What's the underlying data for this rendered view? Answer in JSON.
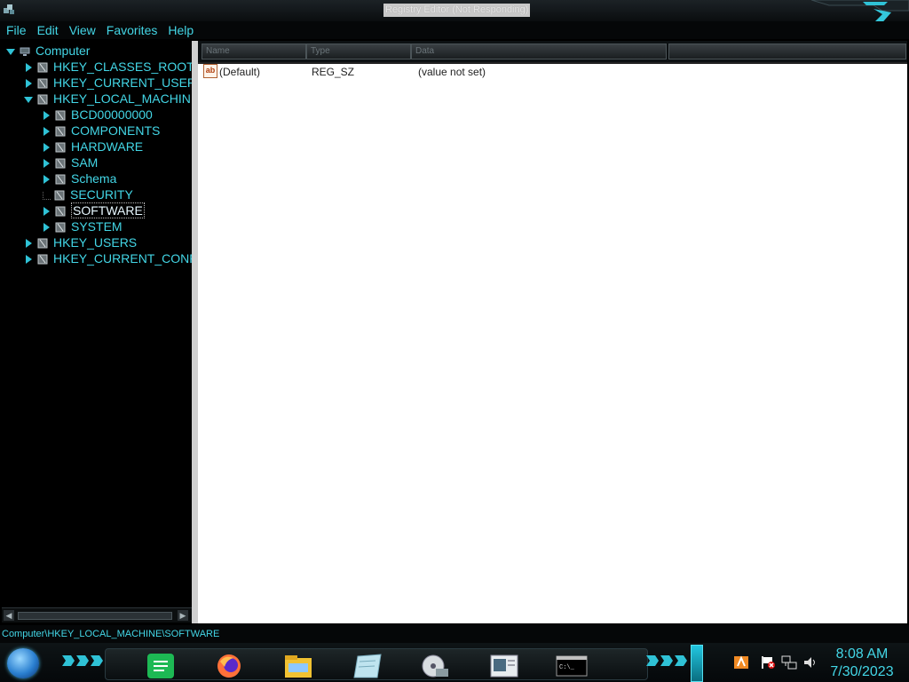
{
  "window": {
    "title": "Registry Editor (Not Responding)"
  },
  "menu": [
    {
      "id": "file",
      "label": "File"
    },
    {
      "id": "edit",
      "label": "Edit"
    },
    {
      "id": "view",
      "label": "View"
    },
    {
      "id": "favorites",
      "label": "Favorites"
    },
    {
      "id": "help",
      "label": "Help"
    }
  ],
  "tree": {
    "root": "Computer",
    "hives": {
      "classes_root": "HKEY_CLASSES_ROOT",
      "current_user": "HKEY_CURRENT_USER",
      "local_machine": "HKEY_LOCAL_MACHINE",
      "users": "HKEY_USERS",
      "current_config": "HKEY_CURRENT_CONFI"
    },
    "local_machine_children": [
      "BCD00000000",
      "COMPONENTS",
      "HARDWARE",
      "SAM",
      "Schema",
      "SECURITY",
      "SOFTWARE",
      "SYSTEM"
    ],
    "selected": "SOFTWARE"
  },
  "list": {
    "columns": [
      "Name",
      "Type",
      "Data"
    ],
    "rows": [
      {
        "name": "(Default)",
        "type": "REG_SZ",
        "data": "(value not set)"
      }
    ]
  },
  "status": {
    "path": "Computer\\HKEY_LOCAL_MACHINE\\SOFTWARE"
  },
  "taskbar": {
    "apps": [
      "spotify-icon",
      "firefox-icon",
      "file-explorer-icon",
      "notepad-icon",
      "disc-tool-icon",
      "document-viewer-icon",
      "command-prompt-icon"
    ],
    "tray": [
      "app-tray-icon",
      "flag-icon",
      "network-icon",
      "speaker-icon"
    ],
    "clock": {
      "time": "8:08 AM",
      "date": "7/30/2023"
    }
  },
  "colors": {
    "accent": "#43d6e6",
    "background": "#000000",
    "list_background": "#ffffff"
  }
}
